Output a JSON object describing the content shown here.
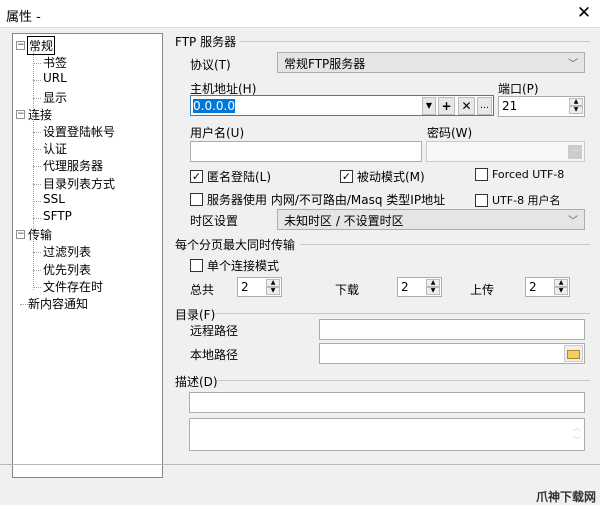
{
  "window": {
    "title": "属性 -",
    "close": "✕"
  },
  "tree": {
    "items": [
      {
        "label": "常规",
        "level": 0
      },
      {
        "label": "书签",
        "level": 1
      },
      {
        "label": "URL",
        "level": 1
      },
      {
        "label": "显示",
        "level": 1
      },
      {
        "label": "连接",
        "level": 0
      },
      {
        "label": "设置登陆帐号",
        "level": 1
      },
      {
        "label": "认证",
        "level": 1
      },
      {
        "label": "代理服务器",
        "level": 1
      },
      {
        "label": "目录列表方式",
        "level": 1
      },
      {
        "label": "SSL",
        "level": 1
      },
      {
        "label": "SFTP",
        "level": 1
      },
      {
        "label": "传输",
        "level": 0
      },
      {
        "label": "过滤列表",
        "level": 1
      },
      {
        "label": "优先列表",
        "level": 1
      },
      {
        "label": "文件存在时",
        "level": 1
      },
      {
        "label": "新内容通知",
        "level": 0
      }
    ],
    "selected": "常规"
  },
  "ftp": {
    "group": "FTP 服务器",
    "protocol_label": "协议(T)",
    "protocol_value": "常规FTP服务器",
    "host_label": "主机地址(H)",
    "host_value": "0.0.0.0",
    "port_label": "端口(P)",
    "port_value": "21",
    "user_label": "用户名(U)",
    "user_value": "",
    "password_label": "密码(W)",
    "password_value": "",
    "anonymous": {
      "label": "匿名登陆(L)",
      "checked": true
    },
    "passive": {
      "label": "被动模式(M)",
      "checked": true
    },
    "forced_utf8": {
      "label": "Forced UTF-8",
      "checked": false
    },
    "masq": {
      "label": "服务器使用 内网/不可路由/Masq 类型IP地址",
      "checked": false
    },
    "utf8_user": {
      "label": "UTF-8 用户名",
      "checked": false
    },
    "timezone_label": "时区设置",
    "timezone_value": "未知时区 / 不设置时区"
  },
  "transfer": {
    "group": "每个分页最大同时传输",
    "single": {
      "label": "单个连接模式",
      "checked": false
    },
    "total_label": "总共",
    "total": "2",
    "download_label": "下载",
    "download": "2",
    "upload_label": "上传",
    "upload": "2"
  },
  "dirs": {
    "group": "目录(F)",
    "remote_label": "远程路径",
    "remote_value": "",
    "local_label": "本地路径",
    "local_value": ""
  },
  "desc": {
    "group": "描述(D)",
    "line_value": "",
    "text_value": ""
  },
  "watermark": "爪神下载网"
}
